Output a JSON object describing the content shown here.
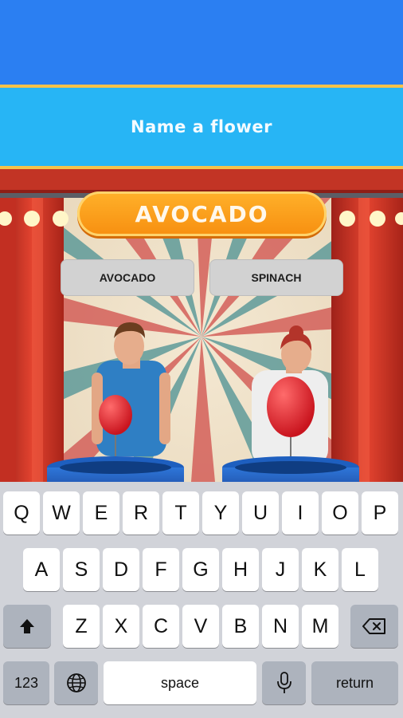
{
  "prompt": {
    "text": "Name a flower"
  },
  "answer": {
    "text": "AVOCADO"
  },
  "choices": [
    {
      "label": "AVOCADO"
    },
    {
      "label": "SPINACH"
    }
  ],
  "keyboard": {
    "row1": [
      "Q",
      "W",
      "E",
      "R",
      "T",
      "Y",
      "U",
      "I",
      "O",
      "P"
    ],
    "row2": [
      "A",
      "S",
      "D",
      "F",
      "G",
      "H",
      "J",
      "K",
      "L"
    ],
    "row3": [
      "Z",
      "X",
      "C",
      "V",
      "B",
      "N",
      "M"
    ],
    "numbers_label": "123",
    "space_label": "space",
    "return_label": "return",
    "shift_icon": "shift-arrow-icon",
    "delete_icon": "backspace-icon",
    "globe_icon": "globe-icon",
    "mic_icon": "microphone-icon"
  },
  "colors": {
    "sky_blue": "#2b7ff2",
    "prompt_bar": "#27b5f5",
    "accent_gold": "#f6c24a",
    "answer_orange": "#f78f10",
    "curtain_red": "#d8392d"
  }
}
